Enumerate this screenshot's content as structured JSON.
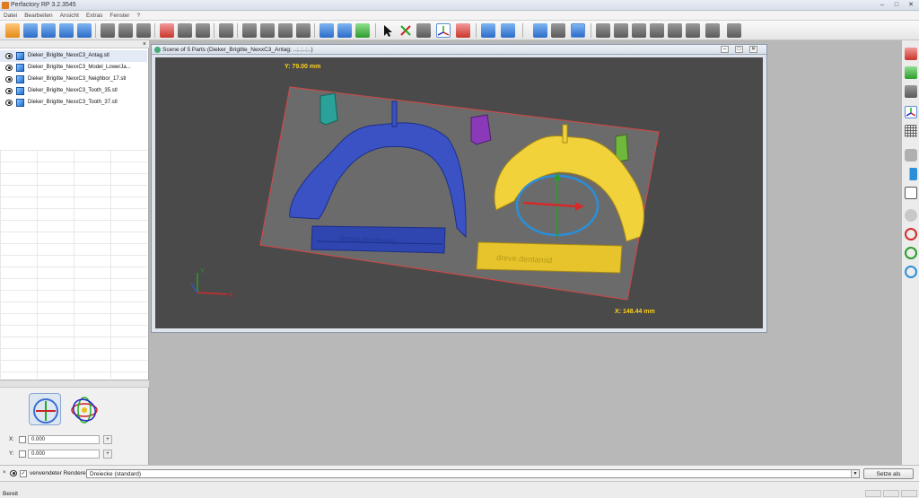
{
  "window": {
    "title": "Perfactory RP 3.2.3545",
    "minimize": "–",
    "maximize": "□",
    "close": "✕"
  },
  "menu": [
    "Datei",
    "Bearbeiten",
    "Ansicht",
    "Extras",
    "Fenster",
    "?"
  ],
  "left_panel": {
    "close": "×",
    "items": [
      {
        "label": "Dieker_Brigitte_NexxC3_Antag.stl"
      },
      {
        "label": "Dieker_Brigitte_NexxC3_Model_LowerJa..."
      },
      {
        "label": "Dieker_Brigitte_NexxC3_Neighbor_17.stl"
      },
      {
        "label": "Dieker_Brigitte_NexxC3_Tooth_35.stl"
      },
      {
        "label": "Dieker_Brigitte_NexxC3_Tooth_37.stl"
      }
    ]
  },
  "transform_panel": {
    "x_label": "X:",
    "x_value": "0.000",
    "y_label": "Y:",
    "y_value": "0.000",
    "spin_symbol": "+"
  },
  "scene": {
    "title": "Scene of 5 Parts (Dieker_Brigitte_NexxC3_Antag; ..;..;..;..)",
    "y_dimension": "Y: 79.00 mm",
    "x_dimension": "X: 148.44 mm",
    "axis_y": "Y",
    "axis_x": "X",
    "model_text": "dreve.dentamid"
  },
  "render": {
    "label": "verwendeter Renderer:",
    "value": "Dreiecke (standard)",
    "default_button": "Setze als Standard"
  },
  "status": {
    "text": "Bereit"
  },
  "colors": {
    "model_blue": "#3a52c4",
    "model_yellow": "#f2d23a",
    "platform_red": "#c84a4a",
    "viewport_bg": "#4a4a4a"
  }
}
